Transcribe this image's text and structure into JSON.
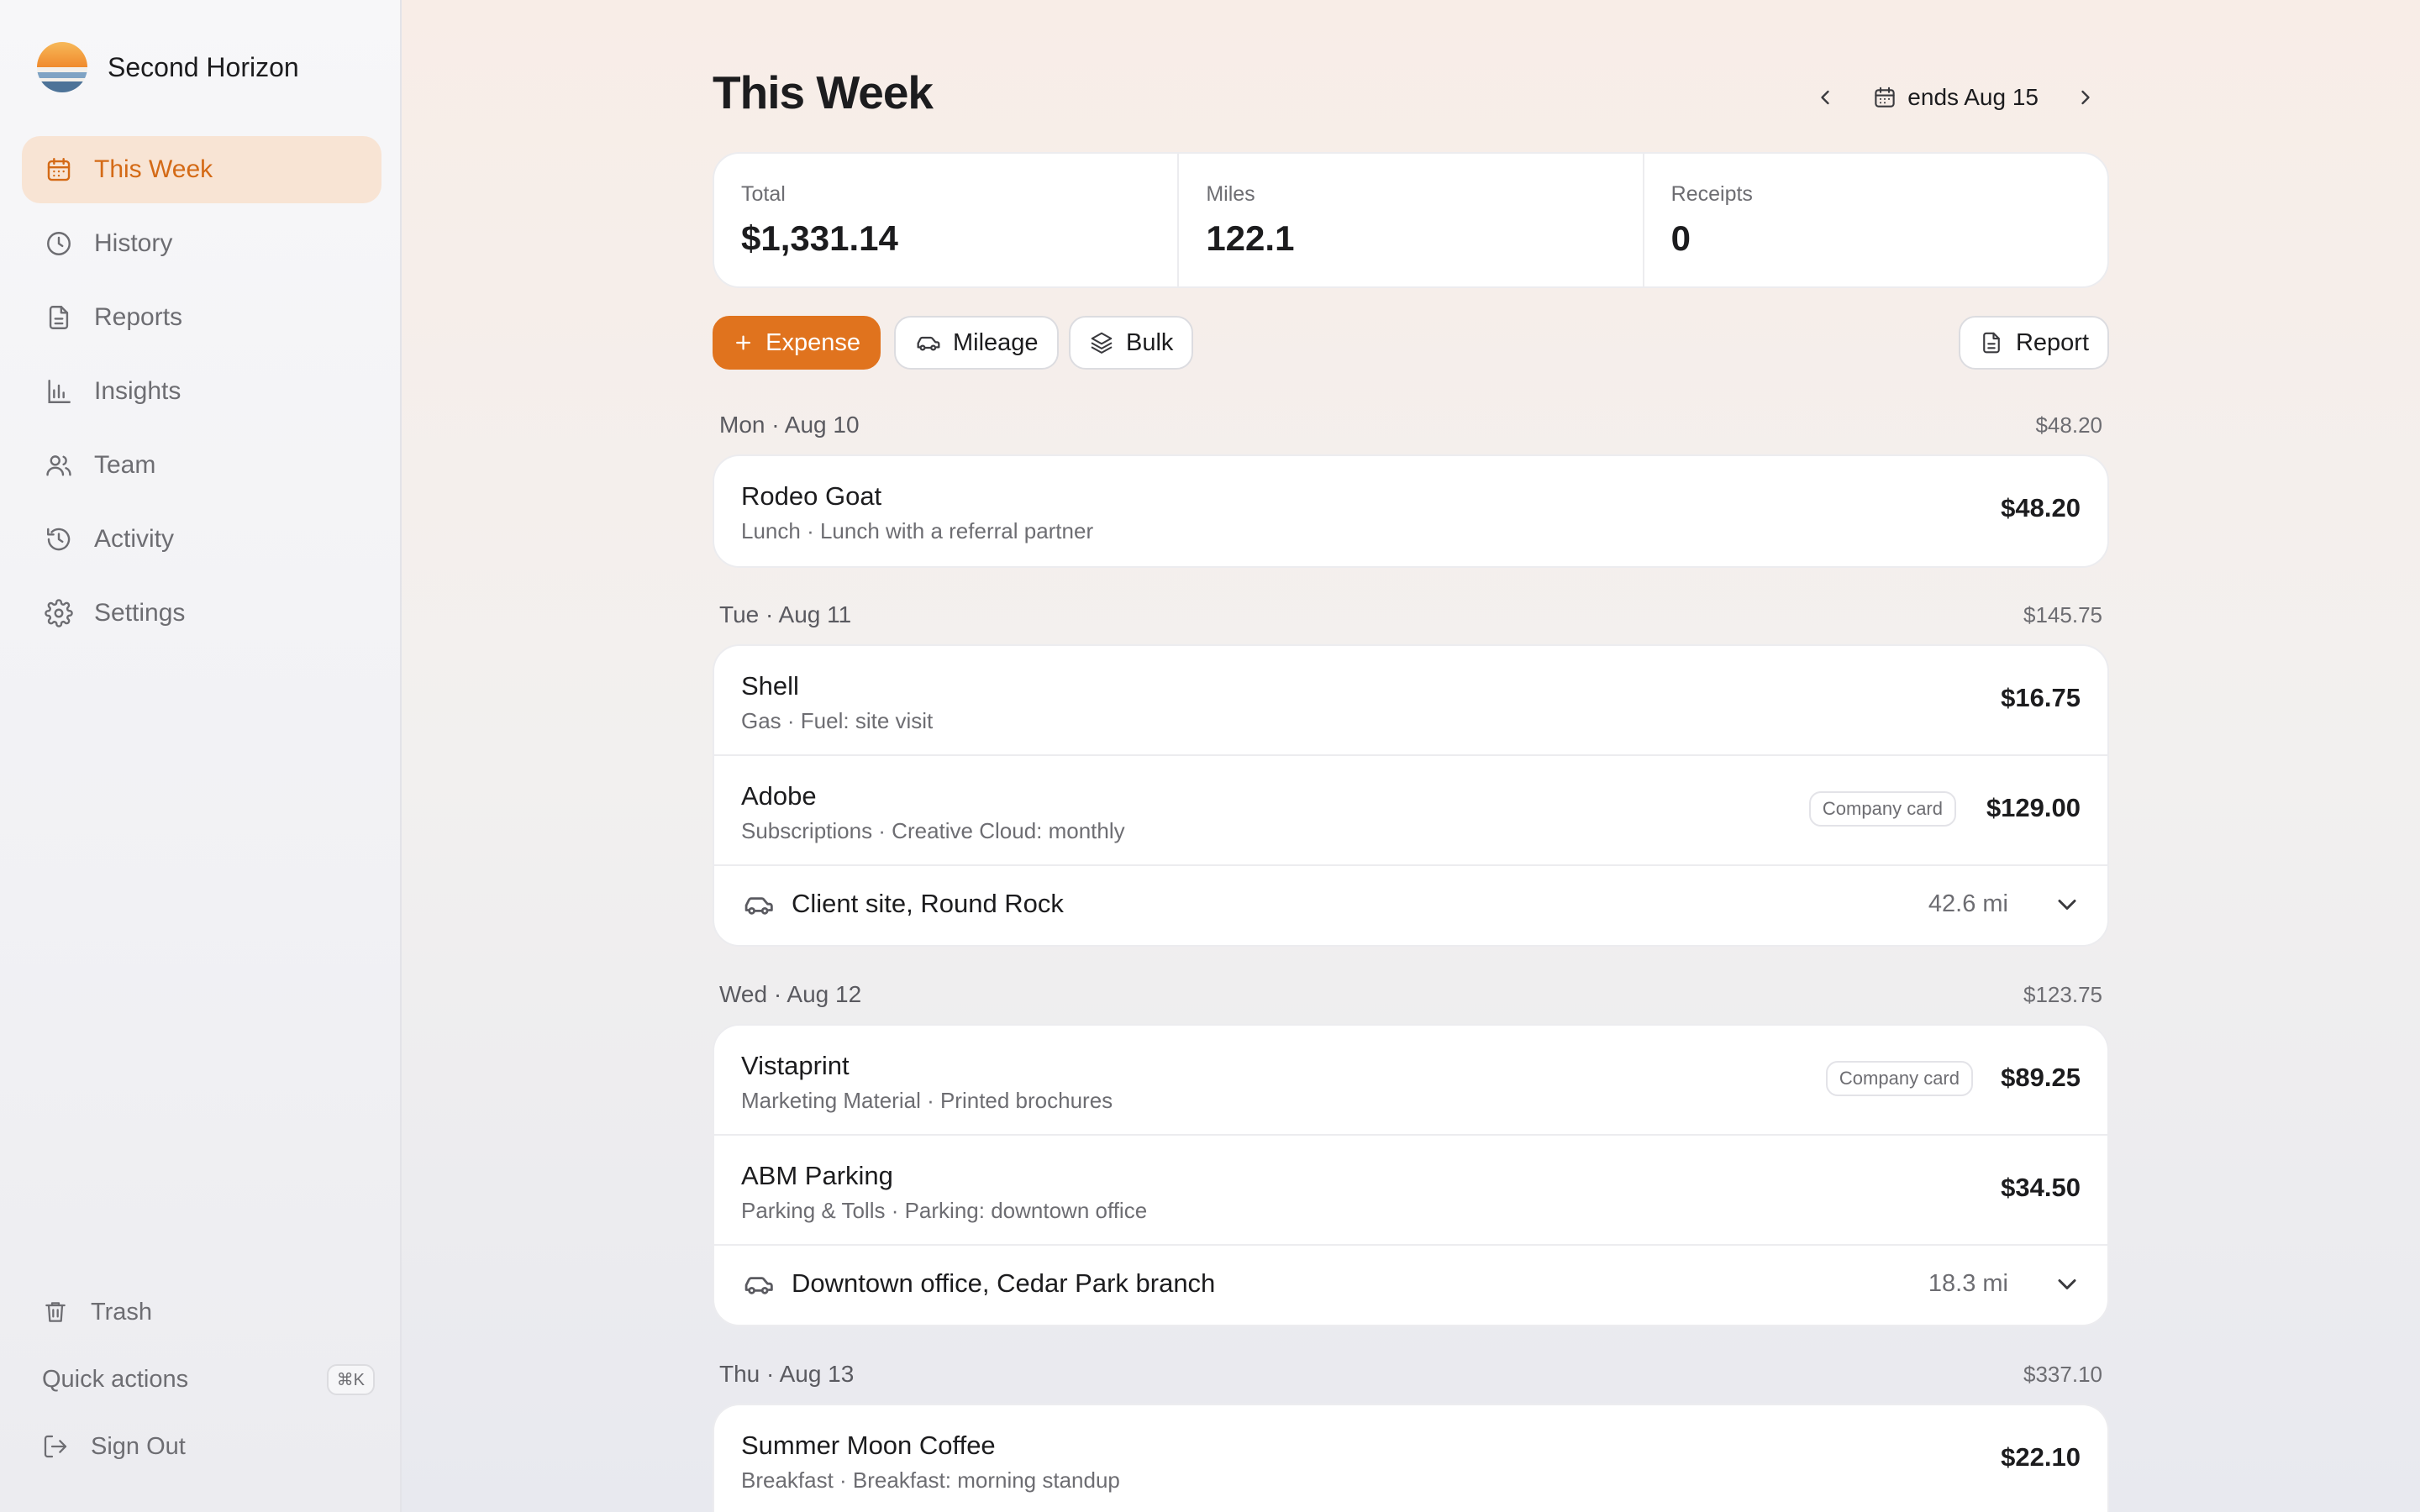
{
  "app": {
    "name": "Second Horizon"
  },
  "sidebar": {
    "items": [
      {
        "label": "This Week",
        "icon": "calendar-icon",
        "active": true
      },
      {
        "label": "History",
        "icon": "clock-icon"
      },
      {
        "label": "Reports",
        "icon": "document-icon"
      },
      {
        "label": "Insights",
        "icon": "bar-chart-icon"
      },
      {
        "label": "Team",
        "icon": "users-icon"
      },
      {
        "label": "Activity",
        "icon": "history-icon"
      },
      {
        "label": "Settings",
        "icon": "gear-icon"
      }
    ],
    "bottom": {
      "trash": "Trash",
      "quick_actions": "Quick actions",
      "quick_actions_shortcut": "⌘K",
      "sign_out": "Sign Out"
    }
  },
  "header": {
    "title": "This Week",
    "week_label": "ends Aug 15"
  },
  "stats": [
    {
      "label": "Total",
      "value": "$1,331.14"
    },
    {
      "label": "Miles",
      "value": "122.1"
    },
    {
      "label": "Receipts",
      "value": "0"
    }
  ],
  "actions": {
    "expense": "Expense",
    "mileage": "Mileage",
    "bulk": "Bulk",
    "report": "Report"
  },
  "days": [
    {
      "title": "Mon · Aug 10",
      "total": "$48.20",
      "entries": [
        {
          "merchant": "Rodeo Goat",
          "subtitle": "Lunch · Lunch with a referral partner",
          "amount": "$48.20"
        }
      ]
    },
    {
      "title": "Tue · Aug 11",
      "total": "$145.75",
      "entries": [
        {
          "merchant": "Shell",
          "subtitle": "Gas · Fuel: site visit",
          "amount": "$16.75"
        },
        {
          "merchant": "Adobe",
          "subtitle": "Subscriptions · Creative Cloud: monthly",
          "amount": "$129.00",
          "badge": "Company card"
        }
      ],
      "mileage": {
        "name": "Client site, Round Rock",
        "distance": "42.6 mi"
      }
    },
    {
      "title": "Wed · Aug 12",
      "total": "$123.75",
      "entries": [
        {
          "merchant": "Vistaprint",
          "subtitle": "Marketing Material · Printed brochures",
          "amount": "$89.25",
          "badge": "Company card"
        },
        {
          "merchant": "ABM Parking",
          "subtitle": "Parking & Tolls · Parking: downtown office",
          "amount": "$34.50"
        }
      ],
      "mileage": {
        "name": "Downtown office, Cedar Park branch",
        "distance": "18.3 mi"
      }
    },
    {
      "title": "Thu · Aug 13",
      "total": "$337.10",
      "entries": [
        {
          "merchant": "Summer Moon Coffee",
          "subtitle": "Breakfast · Breakfast: morning standup",
          "amount": "$22.10"
        }
      ]
    }
  ],
  "colors": {
    "accent": "#e0731e",
    "active_nav_bg": "#f8e4d4",
    "active_nav_text": "#d46a16"
  }
}
